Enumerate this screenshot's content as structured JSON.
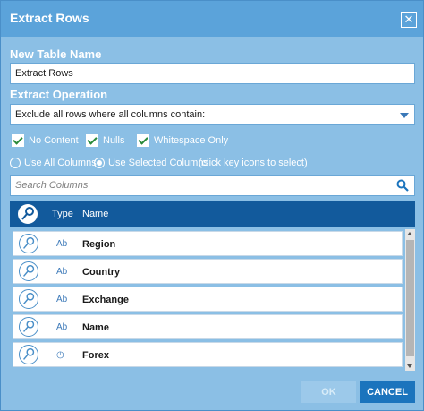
{
  "dialog": {
    "title": "Extract Rows",
    "close_glyph": "✕"
  },
  "table_name": {
    "label": "New Table Name",
    "value": "Extract Rows"
  },
  "operation": {
    "label": "Extract Operation",
    "selected": "Exclude all rows where all columns contain:"
  },
  "checkboxes": [
    {
      "label": "No Content",
      "checked": true
    },
    {
      "label": "Nulls",
      "checked": true
    },
    {
      "label": "Whitespace Only",
      "checked": true
    }
  ],
  "radios": [
    {
      "label": "Use All Columns",
      "selected": false
    },
    {
      "label": "Use Selected Columns",
      "selected": true
    }
  ],
  "radio_hint": "(click key icons to select)",
  "search": {
    "placeholder": "Search Columns",
    "icon": "search-icon"
  },
  "grid": {
    "columns": [
      "Type",
      "Name"
    ],
    "rows": [
      {
        "type": "Ab",
        "name": "Region",
        "icon": "key-icon"
      },
      {
        "type": "Ab",
        "name": "Country",
        "icon": "key-icon"
      },
      {
        "type": "Ab",
        "name": "Exchange",
        "icon": "key-icon"
      },
      {
        "type": "Ab",
        "name": "Name",
        "icon": "key-icon"
      },
      {
        "type": "◷",
        "name": "Forex",
        "icon": "key-icon"
      }
    ]
  },
  "buttons": {
    "ok": "OK",
    "cancel": "CANCEL"
  },
  "colors": {
    "titlebar": "#5ba3da",
    "background": "#8bbfe5",
    "grid_header": "#125a9c",
    "primary_button": "#1b74bd"
  }
}
